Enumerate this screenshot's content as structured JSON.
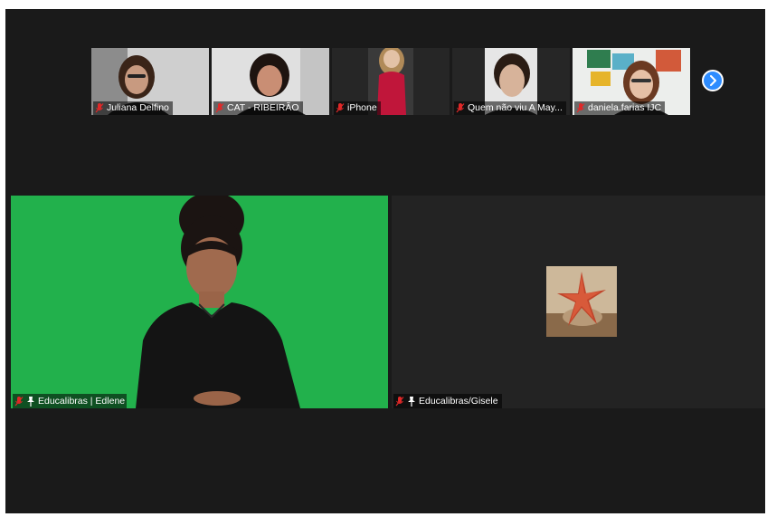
{
  "strip": {
    "participants": [
      {
        "name": "Juliana Delfino",
        "muted": true,
        "bg": "#5a5a5a",
        "skin": "#c89a80",
        "hair": "#3a2418"
      },
      {
        "name": "CAT - RIBEIRÃO",
        "muted": true,
        "bg": "#dcdcdc",
        "skin": "#c98e74",
        "hair": "#1e1410"
      },
      {
        "name": "iPhone",
        "muted": true,
        "bg": "#2a2a2a",
        "skin": "#e3c2a6",
        "hair": "#b08a58"
      },
      {
        "name": "Quem não viu A May...",
        "muted": true,
        "bg": "#2a2a2a",
        "skin": "#d7b39a",
        "hair": "#2a1c14"
      },
      {
        "name": "daniela.farias IJC",
        "muted": true,
        "bg": "#e8ece9",
        "skin": "#e6c0a6",
        "hair": "#6b3a22"
      }
    ],
    "next_label": "›"
  },
  "main": {
    "left": {
      "name": "Educalibras | Edlene Silva",
      "muted": true,
      "pinned": true,
      "bg": "#22b14c"
    },
    "right": {
      "name": "Educalibras/Gisele",
      "muted": true,
      "pinned": true,
      "bg": "#232323"
    }
  },
  "colors": {
    "accent": "#2d8cff",
    "muted_mic": "#e02828",
    "background": "#1a1a1a"
  },
  "icons": {
    "mic": "mic-muted-icon",
    "pin": "pin-icon",
    "next": "chevron-right-icon"
  }
}
